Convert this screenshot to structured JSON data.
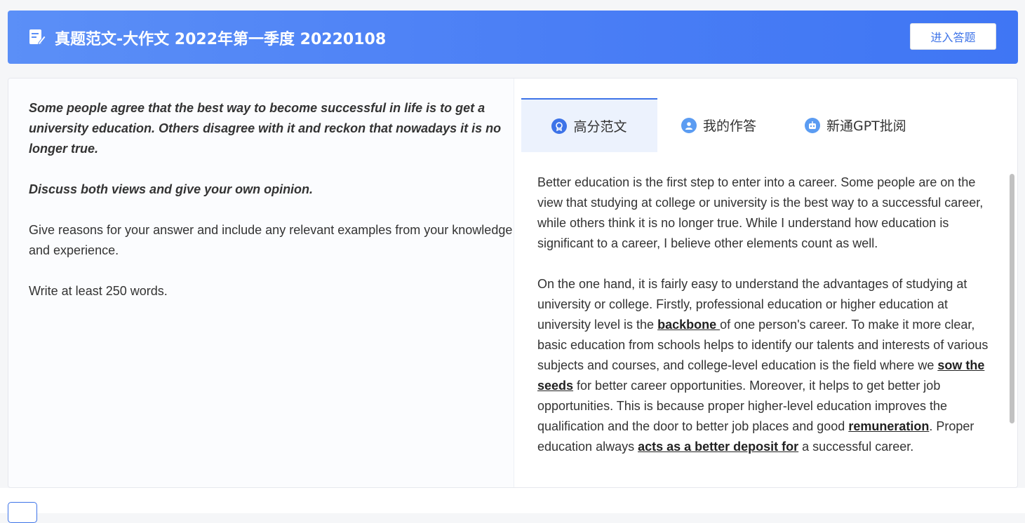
{
  "header": {
    "title": "真题范文-大作文 2022年第一季度 20220108",
    "enter_button": "进入答题",
    "icon": "edit-document-icon"
  },
  "prompt": {
    "question": "Some people agree that the best way to become successful in life is to get a university education. Others disagree with it and reckon that nowadays it is no longer true.",
    "task": "Discuss both views and give your own opinion.",
    "instruction": "Give reasons for your answer and include any relevant examples from your knowledge and experience.",
    "word_count": "Write at least 250 words."
  },
  "tabs": [
    {
      "label": "高分范文",
      "icon": "medal-icon",
      "active": true
    },
    {
      "label": "我的作答",
      "icon": "user-icon",
      "active": false
    },
    {
      "label": "新通GPT批阅",
      "icon": "robot-icon",
      "active": false
    }
  ],
  "essay": {
    "p1": "Better education is the first step to enter into a career. Some people are on the view that studying at college or university is the best way to a successful career, while others think it is no longer true. While I understand how education is significant to a career, I believe other elements count as well.",
    "p2_a": "On the one hand, it is fairly easy to understand the advantages of studying at university or college. Firstly, professional education or higher education at university level is the ",
    "p2_k1": "backbone ",
    "p2_b": "of one person's career. To make it more clear, basic education from schools helps to identify our talents and interests of various subjects and courses, and college-level education is the field where we ",
    "p2_k2": "sow the seeds",
    "p2_c": " for better career opportunities. Moreover, it helps to get better job opportunities. This is because proper higher-level education improves the qualification and the door to better job places and good ",
    "p2_k3": "remuneration",
    "p2_d": ".  Proper education always ",
    "p2_k4": "acts as a better deposit for",
    "p2_e": " a successful career."
  },
  "colors": {
    "accent": "#3d73e8",
    "header_gradient_start": "#5b8ff7",
    "header_gradient_end": "#3f76f4"
  }
}
